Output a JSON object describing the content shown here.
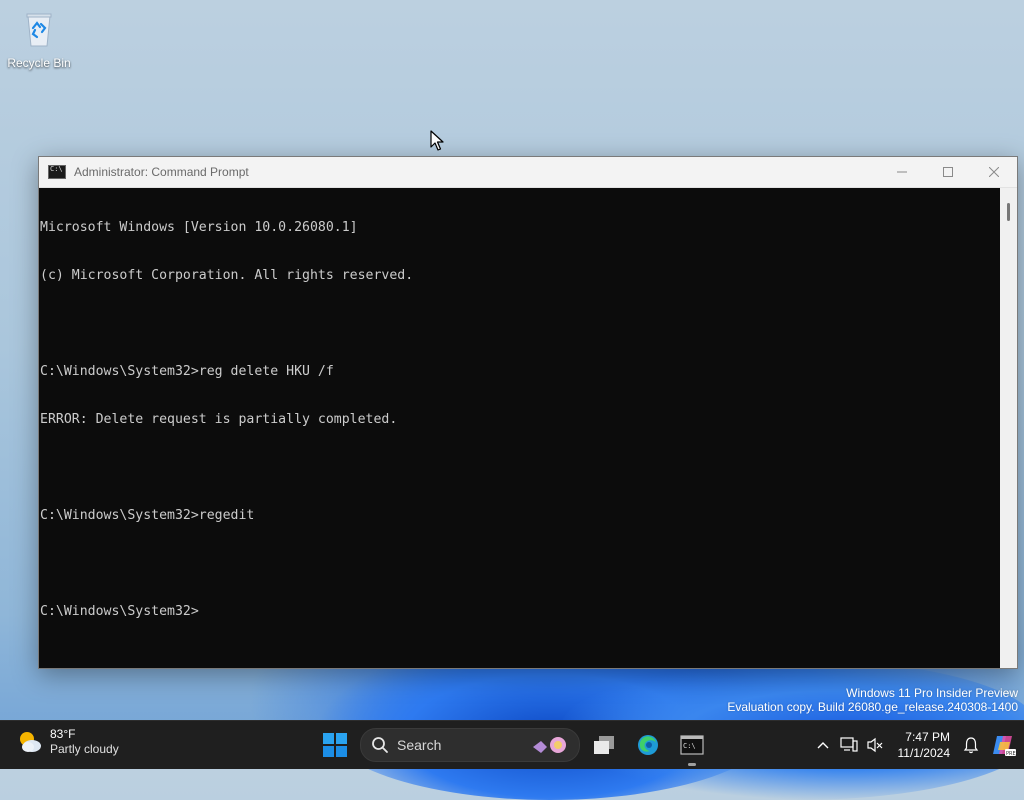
{
  "desktop": {
    "icons": [
      {
        "label": "Recycle Bin",
        "icon": "recycle-bin-icon"
      }
    ]
  },
  "window": {
    "title": "Administrator: Command Prompt",
    "console_lines": [
      "Microsoft Windows [Version 10.0.26080.1]",
      "(c) Microsoft Corporation. All rights reserved.",
      "",
      "C:\\Windows\\System32>reg delete HKU /f",
      "ERROR: Delete request is partially completed.",
      "",
      "C:\\Windows\\System32>regedit",
      "",
      "C:\\Windows\\System32>"
    ]
  },
  "watermark": {
    "line1": "Windows 11 Pro Insider Preview",
    "line2": "Evaluation copy. Build 26080.ge_release.240308-1400"
  },
  "taskbar": {
    "weather": {
      "temp": "83°F",
      "condition": "Partly cloudy",
      "icon": "partly-cloudy-icon"
    },
    "search_label": "Search",
    "apps": [
      "task-view-icon",
      "edge-icon",
      "terminal-icon"
    ],
    "clock": {
      "time": "7:47 PM",
      "date": "11/1/2024"
    }
  },
  "colors": {
    "console_bg": "#0c0c0c",
    "console_fg": "#cccccc",
    "taskbar_bg": "#1f1f1f",
    "accent": "#0078d4"
  }
}
